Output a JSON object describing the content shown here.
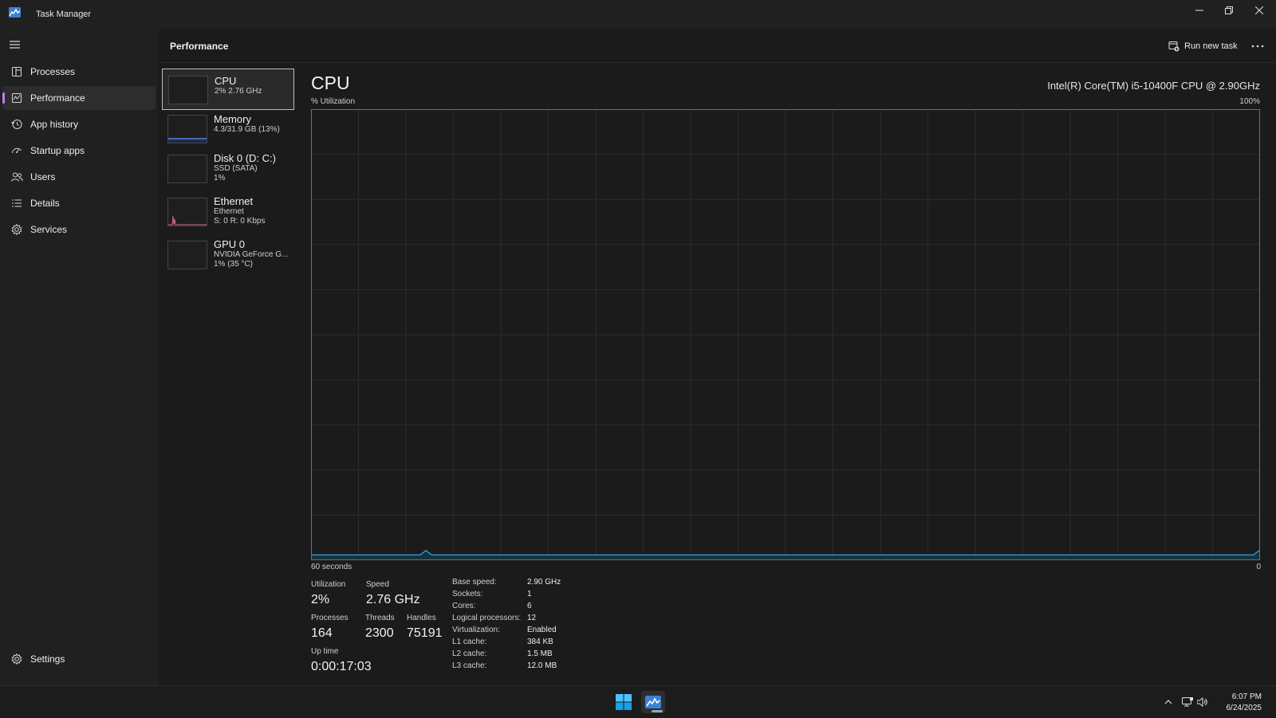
{
  "window": {
    "title": "Task Manager"
  },
  "sidebar": {
    "items": [
      {
        "label": "Processes",
        "icon": "processes-icon"
      },
      {
        "label": "Performance",
        "icon": "performance-icon",
        "active": true
      },
      {
        "label": "App history",
        "icon": "app-history-icon"
      },
      {
        "label": "Startup apps",
        "icon": "startup-apps-icon"
      },
      {
        "label": "Users",
        "icon": "users-icon"
      },
      {
        "label": "Details",
        "icon": "details-icon"
      },
      {
        "label": "Services",
        "icon": "services-icon"
      }
    ],
    "settings_label": "Settings"
  },
  "header": {
    "title": "Performance",
    "run_new_task": "Run new task"
  },
  "devices": [
    {
      "name": "CPU",
      "line1": "2% 2.76 GHz",
      "line2": ""
    },
    {
      "name": "Memory",
      "line1": "4.3/31.9 GB (13%)",
      "line2": ""
    },
    {
      "name": "Disk 0 (D: C:)",
      "line1": "SSD (SATA)",
      "line2": "1%"
    },
    {
      "name": "Ethernet",
      "line1": "Ethernet",
      "line2": "S: 0 R: 0 Kbps"
    },
    {
      "name": "GPU 0",
      "line1": "NVIDIA GeForce G...",
      "line2": "1% (35 °C)"
    }
  ],
  "detail": {
    "title": "CPU",
    "model": "Intel(R) Core(TM) i5-10400F CPU @ 2.90GHz",
    "y_label": "% Utilization",
    "y_max_label": "100%",
    "x_label": "60 seconds",
    "x_min_label": "0",
    "stats": {
      "utilization_label": "Utilization",
      "utilization": "2%",
      "speed_label": "Speed",
      "speed": "2.76 GHz",
      "processes_label": "Processes",
      "processes": "164",
      "threads_label": "Threads",
      "threads": "2300",
      "handles_label": "Handles",
      "handles": "75191",
      "uptime_label": "Up time",
      "uptime": "0:00:17:03"
    },
    "specs": [
      {
        "label": "Base speed:",
        "value": "2.90 GHz"
      },
      {
        "label": "Sockets:",
        "value": "1"
      },
      {
        "label": "Cores:",
        "value": "6"
      },
      {
        "label": "Logical processors:",
        "value": "12"
      },
      {
        "label": "Virtualization:",
        "value": "Enabled"
      },
      {
        "label": "L1 cache:",
        "value": "384 KB"
      },
      {
        "label": "L2 cache:",
        "value": "1.5 MB"
      },
      {
        "label": "L3 cache:",
        "value": "12.0 MB"
      }
    ]
  },
  "chart_data": {
    "type": "line",
    "y_label": "% Utilization",
    "x_label": "60 seconds",
    "ylim": [
      0,
      100
    ],
    "xlim": [
      60,
      0
    ],
    "grid": true,
    "series": [
      {
        "color": "#3aa0d8",
        "values": [
          1,
          1,
          1,
          1,
          1,
          1,
          1,
          1,
          1,
          1,
          1,
          1,
          1,
          1,
          1,
          1,
          1,
          1,
          1,
          1,
          2,
          1,
          1,
          1,
          1,
          1,
          1,
          1,
          1,
          1,
          1,
          1,
          1,
          1,
          1,
          1,
          1,
          1,
          1,
          1,
          1,
          1,
          1,
          1,
          1,
          1,
          1,
          1,
          1,
          1,
          1,
          1,
          1,
          1,
          1,
          1,
          1,
          1,
          1,
          1,
          1,
          1,
          1,
          1,
          1,
          1,
          1,
          1,
          1,
          1,
          1,
          1,
          1,
          1,
          1,
          1,
          1,
          1,
          1,
          1,
          1,
          1,
          1,
          1,
          1,
          1,
          1,
          1,
          1,
          1,
          1,
          1,
          1,
          1,
          1,
          1,
          1,
          1,
          1,
          1,
          1,
          1,
          1,
          1,
          1,
          1,
          1,
          1,
          1,
          1,
          1,
          1,
          1,
          1,
          1,
          1,
          1,
          1,
          1,
          1,
          1,
          1,
          1,
          1,
          1,
          1,
          1,
          1,
          1,
          1,
          1,
          1,
          1,
          1,
          1,
          1,
          1,
          1,
          1,
          1,
          1,
          1,
          1,
          1,
          1,
          1,
          1,
          1,
          1,
          1,
          1,
          1,
          1,
          1,
          1,
          1,
          1,
          1,
          1,
          1,
          1,
          1,
          1,
          1,
          1,
          1,
          2
        ]
      }
    ]
  },
  "colors": {
    "cpu_line": "#3aa0d8",
    "memory_line": "#5f7ee0",
    "ethernet_line": "#d2698f",
    "accent": "#c57ce8"
  },
  "taskbar": {
    "time": "6:07 PM",
    "date": "6/24/2025"
  }
}
